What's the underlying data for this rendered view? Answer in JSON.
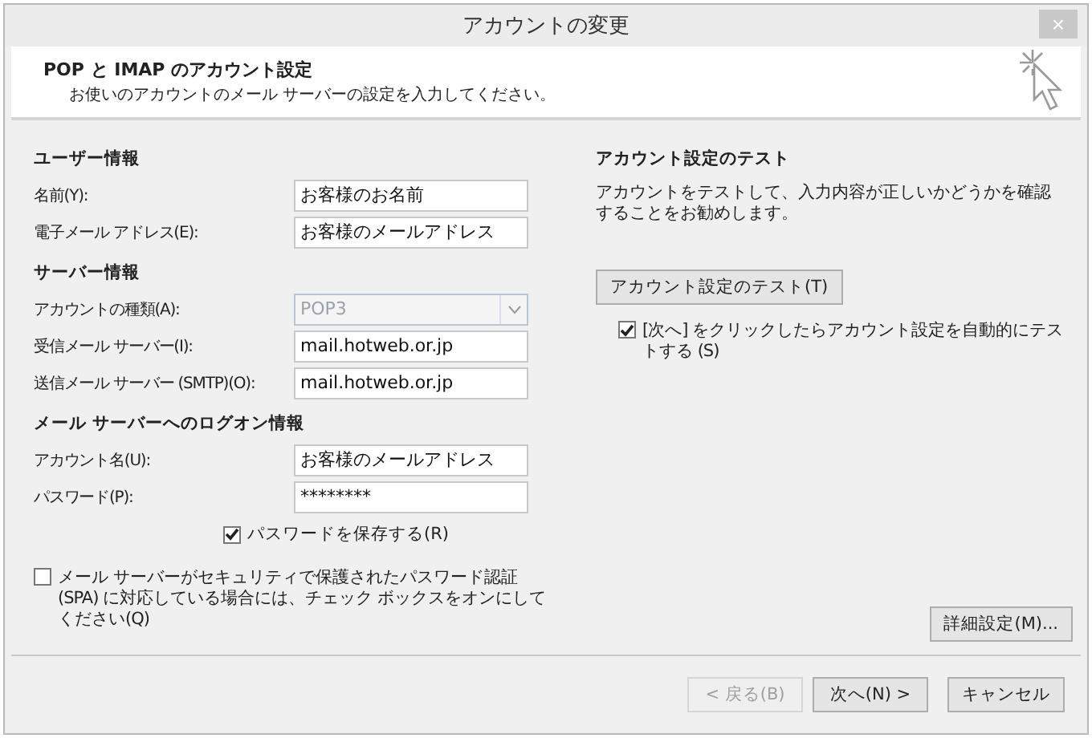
{
  "window": {
    "title": "アカウントの変更",
    "close": "×"
  },
  "header": {
    "heading": "POP と IMAP のアカウント設定",
    "subtitle": "お使いのアカウントのメール サーバーの設定を入力してください。"
  },
  "sections": [
    {
      "heading": "ユーザー情報",
      "fields": [
        {
          "label": "名前(Y):",
          "kind": "text",
          "value": "お客様のお名前",
          "disabled": false
        },
        {
          "label": "電子メール アドレス(E):",
          "kind": "text",
          "value": "お客様のメールアドレス",
          "disabled": false
        }
      ]
    },
    {
      "heading": "サーバー情報",
      "fields": [
        {
          "label": "アカウントの種類(A):",
          "kind": "select",
          "value": "POP3",
          "disabled": true
        },
        {
          "label": "受信メール サーバー(I):",
          "kind": "text",
          "value": "mail.hotweb.or.jp",
          "disabled": false
        },
        {
          "label": "送信メール サーバー (SMTP)(O):",
          "kind": "text",
          "value": "mail.hotweb.or.jp",
          "disabled": false
        }
      ]
    },
    {
      "heading": "メール サーバーへのログオン情報",
      "fields": [
        {
          "label": "アカウント名(U):",
          "kind": "text",
          "value": "お客様のメールアドレス",
          "disabled": false
        },
        {
          "label": "パスワード(P):",
          "kind": "text",
          "value": "********",
          "disabled": false
        }
      ]
    }
  ],
  "save_password": {
    "label": "パスワードを保存する(R)",
    "checked": true
  },
  "spa": {
    "label": "メール サーバーがセキュリティで保護されたパスワード認証 (SPA) に対応している場合には、チェック ボックスをオンにしてください(Q)",
    "checked": false
  },
  "test": {
    "heading": "アカウント設定のテスト",
    "description": "アカウントをテストして、入力内容が正しいかどうかを確認することをお勧めします。",
    "button": "アカウント設定のテスト(T)",
    "auto_test": {
      "label": "[次へ] をクリックしたらアカウント設定を自動的にテストする (S)",
      "checked": true
    }
  },
  "advanced_button": "詳細設定(M)...",
  "footer_buttons": [
    {
      "label": "< 戻る(B)",
      "disabled": true
    },
    {
      "label": "次へ(N) >",
      "disabled": false
    },
    {
      "label": "キャンセル",
      "disabled": false
    }
  ]
}
